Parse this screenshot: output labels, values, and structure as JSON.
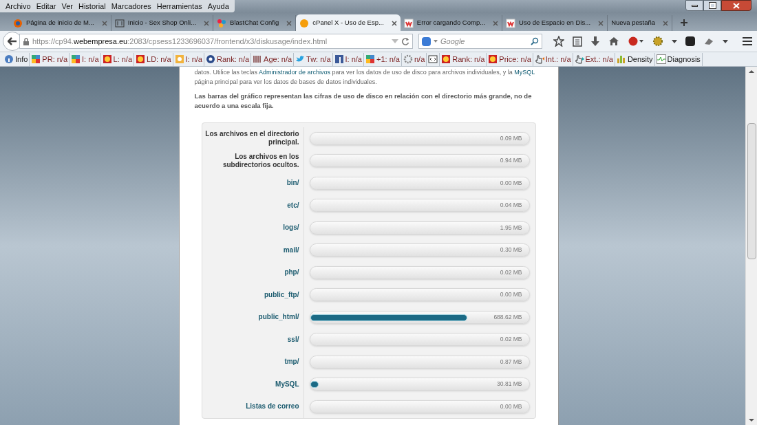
{
  "menu": [
    "Archivo",
    "Editar",
    "Ver",
    "Historial",
    "Marcadores",
    "Herramientas",
    "Ayuda"
  ],
  "tabs": [
    {
      "title": "Página de inicio de M...",
      "selected": false
    },
    {
      "title": "Inicio - Sex Shop Onli...",
      "selected": false
    },
    {
      "title": "BlastChat Config",
      "selected": false
    },
    {
      "title": "cPanel X - Uso de Esp...",
      "selected": true
    },
    {
      "title": "Error cargando Comp...",
      "selected": false
    },
    {
      "title": "Uso de Espacio en Dis...",
      "selected": false
    },
    {
      "title": "Nueva pestaña",
      "selected": false
    }
  ],
  "address": {
    "scheme": "https://cp94.",
    "domain": "webempresa.eu",
    "rest": ":2083/cpsess1233696037/frontend/x3/diskusage/index.html"
  },
  "search": {
    "placeholder": "Google"
  },
  "bookmarks": [
    {
      "kind": "label",
      "label": "Info"
    },
    {
      "kind": "label",
      "label": "PR: n/a"
    },
    {
      "kind": "label",
      "label": "I: n/a"
    },
    {
      "kind": "label",
      "label": "L: n/a"
    },
    {
      "kind": "label",
      "label": "LD: n/a"
    },
    {
      "kind": "label",
      "label": "I: n/a"
    },
    {
      "kind": "label",
      "label": "Rank: n/a"
    },
    {
      "kind": "label",
      "label": "Age: n/a"
    },
    {
      "kind": "label",
      "label": "Tw: n/a"
    },
    {
      "kind": "label",
      "label": "I: n/a"
    },
    {
      "kind": "label",
      "label": "+1: n/a"
    },
    {
      "kind": "label",
      "label": "n/a"
    },
    {
      "kind": "icon"
    },
    {
      "kind": "label",
      "label": "Rank: n/a"
    },
    {
      "kind": "label",
      "label": "Price: n/a"
    },
    {
      "kind": "label",
      "label": "Int.: n/a"
    },
    {
      "kind": "label",
      "label": "Ext.: n/a"
    },
    {
      "kind": "label",
      "label": "Density"
    },
    {
      "kind": "label",
      "label": "Diagnosis"
    }
  ],
  "intro": [
    {
      "kind": "text",
      "text": "datos. Utilice las teclas "
    },
    {
      "kind": "link",
      "text": "Administrador de archivos"
    },
    {
      "kind": "text",
      "text": " para ver los datos de uso de disco para archivos individuales, y la "
    },
    {
      "kind": "link",
      "text": "MySQL"
    },
    {
      "kind": "text",
      "text": " página principal para ver los datos de bases de datos individuales."
    }
  ],
  "note": "Las barras del gráfico representan las cifras de uso de disco en relación con el directorio más grande, no de acuerdo a una escala fija.",
  "usage": [
    {
      "kind": "text",
      "name": "Los archivos en el directorio principal.",
      "reading": "0.09 MB"
    },
    {
      "kind": "text",
      "name": "Los archivos en los subdirectorios ocultos.",
      "reading": "0.94 MB"
    },
    {
      "kind": "link",
      "name": "bin/",
      "reading": "0.00 MB"
    },
    {
      "kind": "link",
      "name": "etc/",
      "reading": "0.04 MB"
    },
    {
      "kind": "link",
      "name": "logs/",
      "reading": "1.95 MB"
    },
    {
      "kind": "link",
      "name": "mail/",
      "reading": "0.30 MB"
    },
    {
      "kind": "link",
      "name": "php/",
      "reading": "0.02 MB"
    },
    {
      "kind": "link",
      "name": "public_ftp/",
      "reading": "0.00 MB"
    },
    {
      "kind": "link",
      "name": "public_html/",
      "level": 0.72,
      "reading": "688.62 MB"
    },
    {
      "kind": "link",
      "name": "ssl/",
      "reading": "0.02 MB"
    },
    {
      "kind": "link",
      "name": "tmp/",
      "reading": "0.87 MB"
    },
    {
      "kind": "link",
      "name": "MySQL",
      "level": 0.04,
      "reading": "30.81 MB"
    },
    {
      "kind": "link",
      "name": "Listas de correo",
      "reading": "0.00 MB"
    }
  ]
}
